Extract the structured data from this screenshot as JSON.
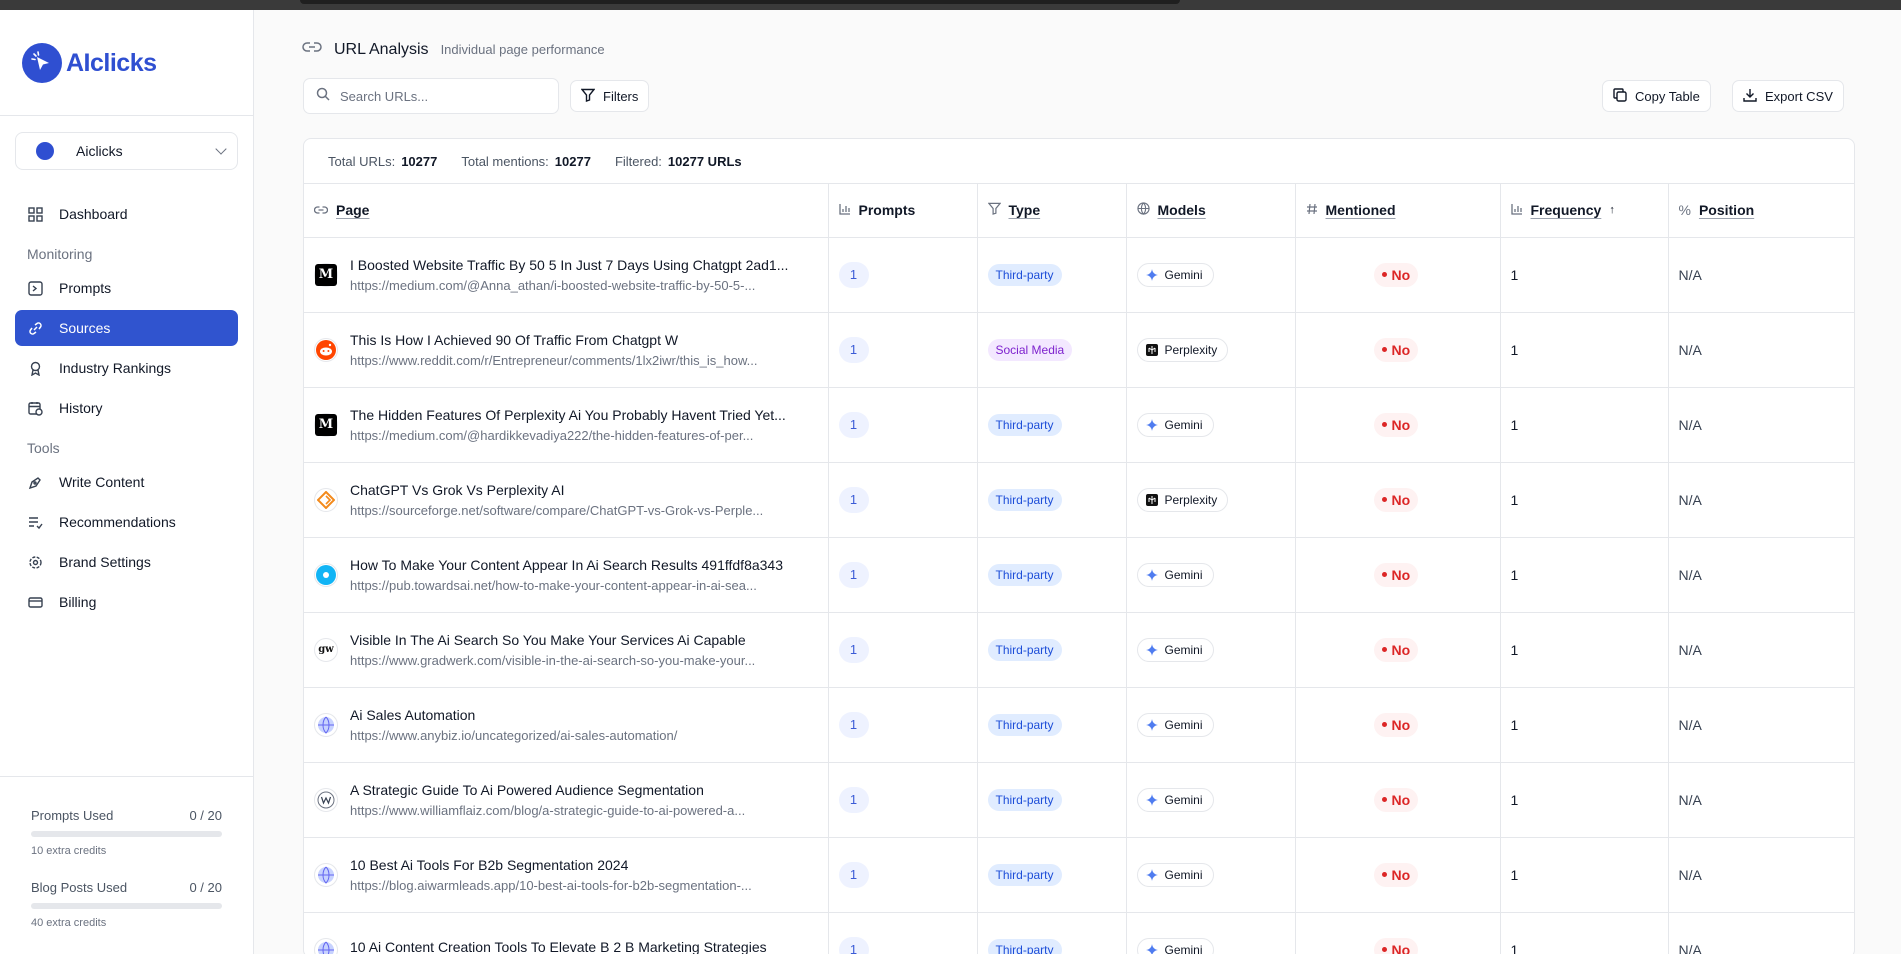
{
  "brand": {
    "name": "AIclicks"
  },
  "workspace": {
    "label": "Aiclicks"
  },
  "nav": {
    "dashboard": "Dashboard",
    "monitoring_section": "Monitoring",
    "prompts": "Prompts",
    "sources": "Sources",
    "industry_rankings": "Industry Rankings",
    "history": "History",
    "tools_section": "Tools",
    "write_content": "Write Content",
    "recommendations": "Recommendations",
    "brand_settings": "Brand Settings",
    "billing": "Billing"
  },
  "usage": {
    "prompts": {
      "label": "Prompts Used",
      "value": "0 / 20",
      "note": "10 extra credits",
      "fraction": 0
    },
    "blog": {
      "label": "Blog Posts Used",
      "value": "0 / 20",
      "note": "40 extra credits",
      "fraction": 0
    }
  },
  "header": {
    "title": "URL Analysis",
    "subtitle": "Individual page performance"
  },
  "toolbar": {
    "search_placeholder": "Search URLs...",
    "filters_label": "Filters",
    "copy_label": "Copy Table",
    "export_label": "Export CSV"
  },
  "stats": {
    "total_urls_label": "Total URLs:",
    "total_urls": "10277",
    "total_mentions_label": "Total mentions:",
    "total_mentions": "10277",
    "filtered_label": "Filtered:",
    "filtered": "10277 URLs"
  },
  "table": {
    "columns": {
      "page": "Page",
      "prompts": "Prompts",
      "type": "Type",
      "models": "Models",
      "mentioned": "Mentioned",
      "frequency": "Frequency",
      "frequency_sort": "↑",
      "position": "Position"
    },
    "rows": [
      {
        "title": "I Boosted Website Traffic By 50 5 In Just 7 Days Using Chatgpt 2ad1...",
        "url": "https://medium.com/@Anna_athan/i-boosted-website-traffic-by-50-5-...",
        "favicon": "medium",
        "prompts": "1",
        "type": "Third-party",
        "type_kind": "third",
        "model": "Gemini",
        "model_kind": "gemini",
        "mentioned": "No",
        "frequency": "1",
        "position": "N/A"
      },
      {
        "title": "This Is How I Achieved 90 Of Traffic From Chatgpt W",
        "url": "https://www.reddit.com/r/Entrepreneur/comments/1lx2iwr/this_is_how...",
        "favicon": "reddit",
        "prompts": "1",
        "type": "Social Media",
        "type_kind": "social",
        "model": "Perplexity",
        "model_kind": "perplexity",
        "mentioned": "No",
        "frequency": "1",
        "position": "N/A"
      },
      {
        "title": "The Hidden Features Of Perplexity Ai You Probably Havent Tried Yet...",
        "url": "https://medium.com/@hardikkevadiya222/the-hidden-features-of-per...",
        "favicon": "medium",
        "prompts": "1",
        "type": "Third-party",
        "type_kind": "third",
        "model": "Gemini",
        "model_kind": "gemini",
        "mentioned": "No",
        "frequency": "1",
        "position": "N/A"
      },
      {
        "title": "ChatGPT Vs Grok Vs Perplexity AI",
        "url": "https://sourceforge.net/software/compare/ChatGPT-vs-Grok-vs-Perple...",
        "favicon": "sourceforge",
        "prompts": "1",
        "type": "Third-party",
        "type_kind": "third",
        "model": "Perplexity",
        "model_kind": "perplexity",
        "mentioned": "No",
        "frequency": "1",
        "position": "N/A"
      },
      {
        "title": "How To Make Your Content Appear In Ai Search Results 491ffdf8a343",
        "url": "https://pub.towardsai.net/how-to-make-your-content-appear-in-ai-sea...",
        "favicon": "towardsai",
        "prompts": "1",
        "type": "Third-party",
        "type_kind": "third",
        "model": "Gemini",
        "model_kind": "gemini",
        "mentioned": "No",
        "frequency": "1",
        "position": "N/A"
      },
      {
        "title": "Visible In The Ai Search So You Make Your Services Ai Capable",
        "url": "https://www.gradwerk.com/visible-in-the-ai-search-so-you-make-your...",
        "favicon": "gradwerk",
        "prompts": "1",
        "type": "Third-party",
        "type_kind": "third",
        "model": "Gemini",
        "model_kind": "gemini",
        "mentioned": "No",
        "frequency": "1",
        "position": "N/A"
      },
      {
        "title": "Ai Sales Automation",
        "url": "https://www.anybiz.io/uncategorized/ai-sales-automation/",
        "favicon": "globe",
        "prompts": "1",
        "type": "Third-party",
        "type_kind": "third",
        "model": "Gemini",
        "model_kind": "gemini",
        "mentioned": "No",
        "frequency": "1",
        "position": "N/A"
      },
      {
        "title": "A Strategic Guide To Ai Powered Audience Segmentation",
        "url": "https://www.williamflaiz.com/blog/a-strategic-guide-to-ai-powered-a...",
        "favicon": "william",
        "prompts": "1",
        "type": "Third-party",
        "type_kind": "third",
        "model": "Gemini",
        "model_kind": "gemini",
        "mentioned": "No",
        "frequency": "1",
        "position": "N/A"
      },
      {
        "title": "10 Best Ai Tools For B2b Segmentation 2024",
        "url": "https://blog.aiwarmleads.app/10-best-ai-tools-for-b2b-segmentation-...",
        "favicon": "globe",
        "prompts": "1",
        "type": "Third-party",
        "type_kind": "third",
        "model": "Gemini",
        "model_kind": "gemini",
        "mentioned": "No",
        "frequency": "1",
        "position": "N/A"
      },
      {
        "title": "10 Ai Content Creation Tools To Elevate B 2 B Marketing Strategies",
        "url": "",
        "favicon": "globe",
        "prompts": "1",
        "type": "Third-party",
        "type_kind": "third",
        "model": "Gemini",
        "model_kind": "gemini",
        "mentioned": "No",
        "frequency": "1",
        "position": "N/A"
      }
    ]
  }
}
